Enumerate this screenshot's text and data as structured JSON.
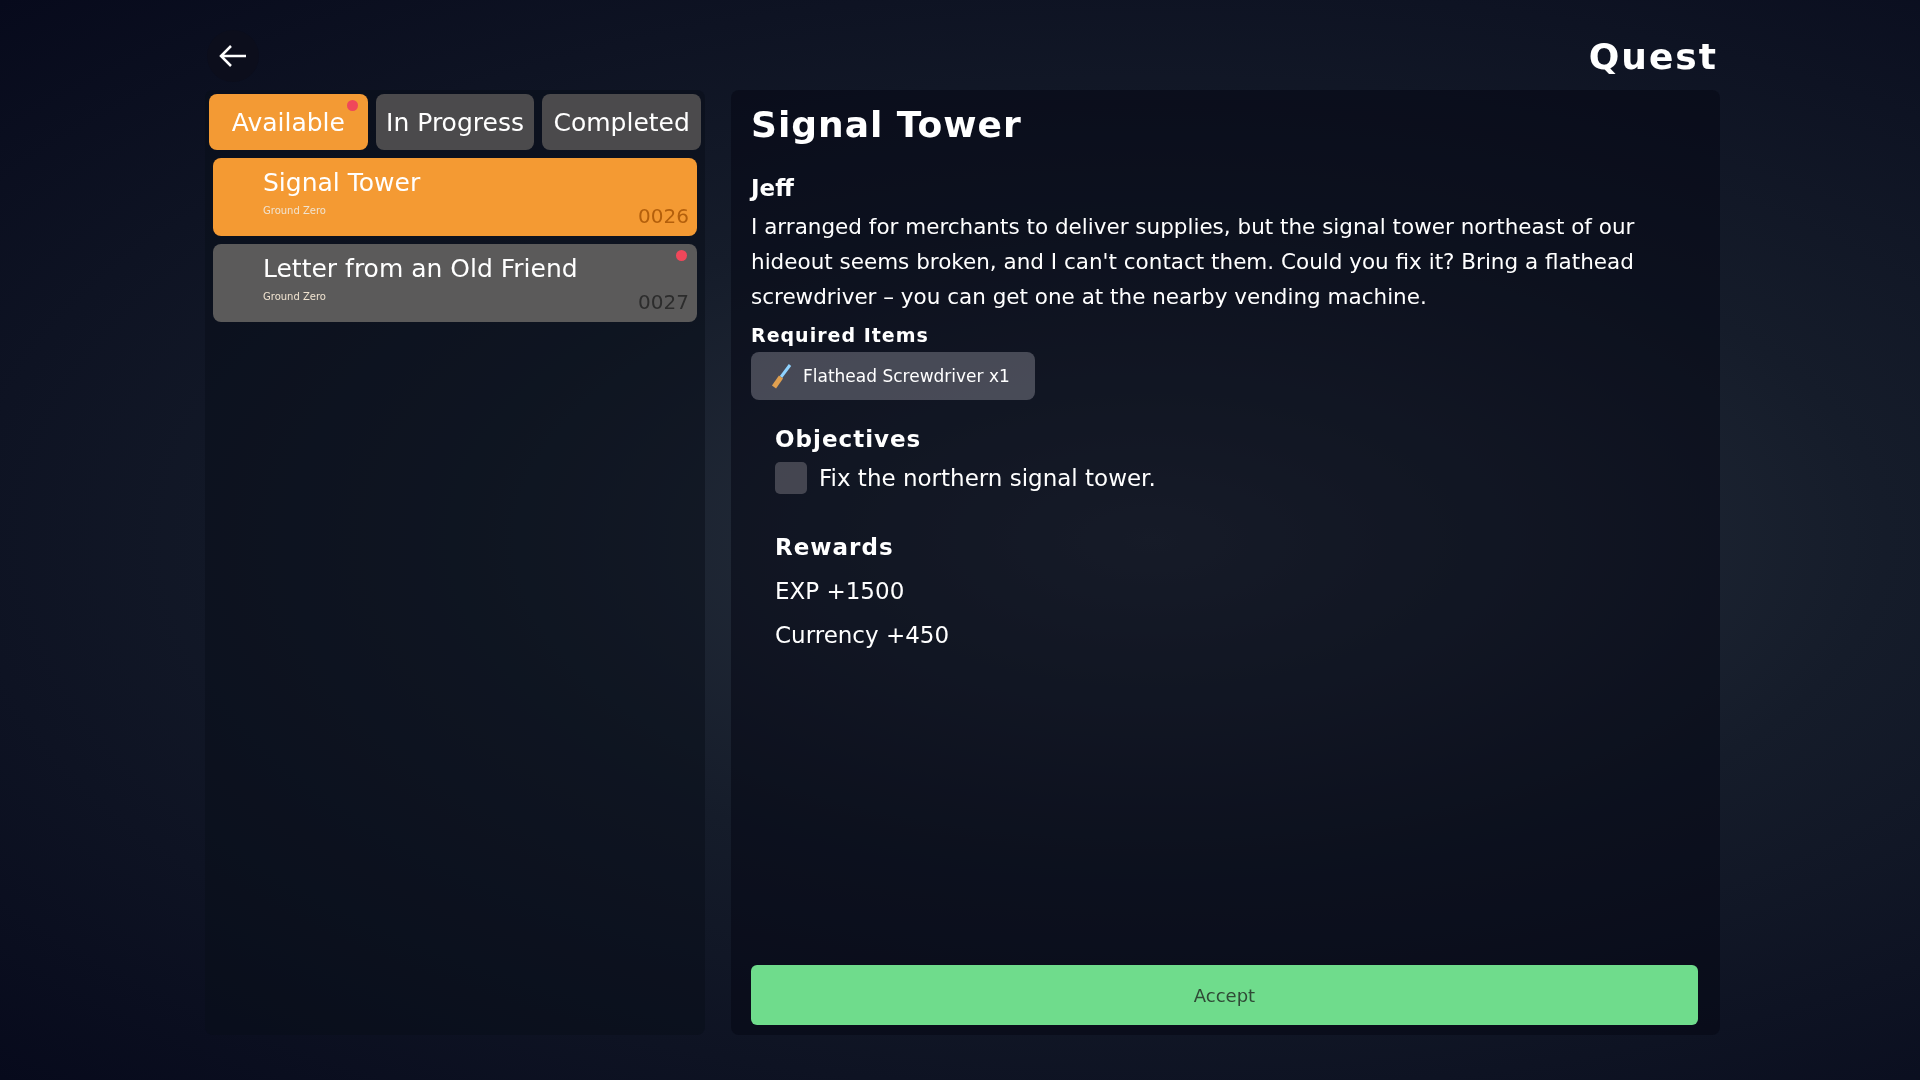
{
  "header": {
    "title": "Quest"
  },
  "tabs": [
    {
      "label": "Available",
      "selected": true,
      "badge": true
    },
    {
      "label": "In Progress",
      "selected": false,
      "badge": false
    },
    {
      "label": "Completed",
      "selected": false,
      "badge": false
    }
  ],
  "quests": [
    {
      "title": "Signal Tower",
      "location": "Ground Zero",
      "number": "0026",
      "selected": true,
      "badge": false
    },
    {
      "title": "Letter from an Old Friend",
      "location": "Ground Zero",
      "number": "0027",
      "selected": false,
      "badge": true
    }
  ],
  "detail": {
    "title": "Signal Tower",
    "giver": "Jeff",
    "description": "I arranged for merchants to deliver supplies, but the signal tower northeast of our hideout seems broken, and I can't contact them. Could you fix it? Bring a flathead screwdriver – you can get one at the nearby vending machine.",
    "required_heading": "Required Items",
    "required_items": [
      "Flathead Screwdriver x1"
    ],
    "objectives_heading": "Objectives",
    "objectives": [
      {
        "text": "Fix the northern signal tower.",
        "checked": false
      }
    ],
    "rewards_heading": "Rewards",
    "rewards": [
      "EXP +1500",
      "Currency +450"
    ],
    "accept_label": "Accept"
  }
}
